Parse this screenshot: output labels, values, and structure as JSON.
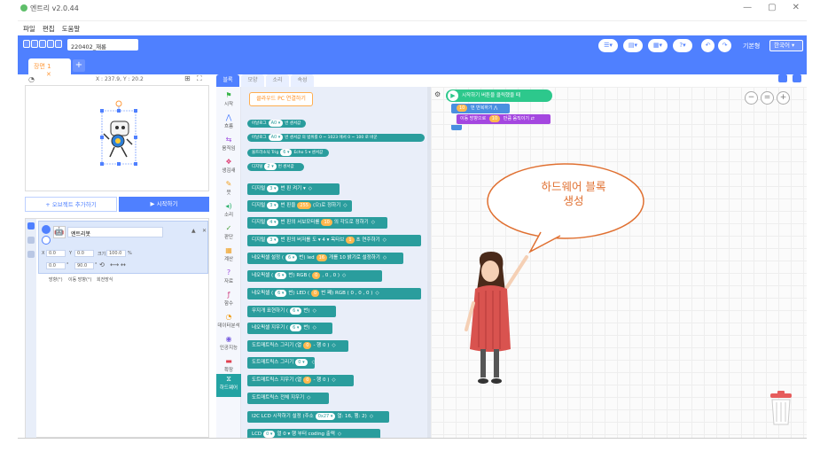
{
  "app": {
    "title": "엔트리 v2.0.44",
    "logo_color": "#5fbf6a"
  },
  "menu": [
    "파일",
    "편집",
    "도움말"
  ],
  "toolbar": {
    "project_name": "220402_재롱",
    "user_label": "기본형",
    "language": "한국어",
    "accent": "#4f80ff"
  },
  "tabs": {
    "scene": "장면 1",
    "close": "✕",
    "add": "+"
  },
  "stage": {
    "coords": "X : 237.9, Y : 20.2",
    "add_object": "+ 오브젝트 추가하기",
    "run": "▶ 시작하기"
  },
  "object": {
    "name": "엔트리봇",
    "x": "0.0",
    "y": "0.0",
    "size_label": "크기",
    "size": "100.0",
    "size_unit": "%",
    "rotation": "0.0",
    "direction": "90.0",
    "rotation_label": "방향(°)",
    "move_label": "이동 방향(°)",
    "mode_label": "회전방식"
  },
  "palette_tabs": [
    "블록",
    "모양",
    "소리",
    "속성"
  ],
  "categories": [
    "시작",
    "흐름",
    "움직임",
    "생김새",
    "붓",
    "소리",
    "판단",
    "계산",
    "자료",
    "함수",
    "데이터분석",
    "인공지능",
    "확장",
    "하드웨어"
  ],
  "palette": {
    "connect": "클라우드 PC 연결하기",
    "small_blocks": [
      {
        "t": "아날로그",
        "p": "A0 ▾",
        "e": "번 센서값"
      },
      {
        "t": "아날로그",
        "p": "A0 ▾",
        "e": "번 센서값  의 범위를  0  ~  1023  에서  0  ~  100  로 바꾼"
      },
      {
        "t": "울트라소닉 Trig",
        "p": "6 ▾",
        "e": "Echo  5 ▾  센서값"
      },
      {
        "t": "디지털",
        "p": "2 ▾",
        "e": "번 센서값"
      }
    ],
    "blocks": [
      {
        "t": "디지털",
        "p": "3 ▾",
        "e": "번 핀  켜기 ▾"
      },
      {
        "t": "디지털",
        "p": "3 ▾",
        "e": "번 핀을",
        "o": "255",
        "e2": "(으)로 정하기"
      },
      {
        "t": "디지털",
        "p": "4 ▾",
        "e": "번 핀의 서보모터를",
        "o": "10",
        "e2": "의 각도로 정하기"
      },
      {
        "t": "디지털",
        "p": "3 ▾",
        "e": "번 핀의 버저를  도 ▾  4 ▾  옥타브",
        "o": "1",
        "e2": "초 연주하기"
      },
      {
        "t": "네오픽셀 설정 (",
        "p": "6 ▾",
        "e": "번) led",
        "o": "16",
        "e2": "개를  10  밝기로 설정하기"
      },
      {
        "t": "네오픽셀 (",
        "p": "6 ▾",
        "e": "번) RGB (",
        "o": "0",
        "e2": ", 0 , 0 )"
      },
      {
        "t": "네오픽셀 (",
        "p": "6 ▾",
        "e": "번) LED (",
        "o": "0",
        "e2": "번 째) RGB ( 0 , 0 , 0 )"
      },
      {
        "t": "무지개 표현하기 (",
        "p": "6 ▾",
        "e": "번)"
      },
      {
        "t": "네오픽셀 지우기 (",
        "p": "6 ▾",
        "e": "번)"
      },
      {
        "t": "도트매트릭스 그리기 (열",
        "o": "0",
        "e": "- 행  0 )"
      },
      {
        "t": "도트매트릭스 그리기",
        "p": "0 ▾",
        "e": ""
      },
      {
        "t": "도트매트릭스 지우기 (열",
        "o": "0",
        "e": "- 행  0 )"
      },
      {
        "t": "도트매트릭스 전체 지우기",
        "e": ""
      },
      {
        "t": "I2C LCD 시작하기 설정 (주소",
        "p": "0x27 ▾",
        "e": "열: 16, 행: 2)"
      },
      {
        "t": "LCD",
        "p": "0 ▾",
        "e": "열  0 ▾  행 부터  coding  출력"
      }
    ]
  },
  "workspace": {
    "start_block": "시작하기 버튼을 클릭했을 때",
    "repeat_count": "10",
    "repeat_label": "번 반복하기",
    "move_count": "10",
    "move_prefix": "이동 방향으로",
    "move_suffix": "만큼 움직이기",
    "bubble_text": "하드웨어 블록\n생성"
  }
}
